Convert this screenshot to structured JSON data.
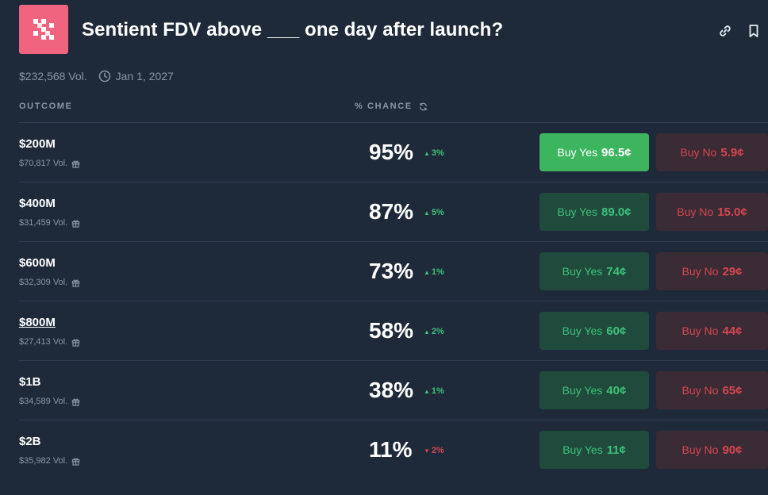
{
  "header": {
    "title": "Sentient FDV above ___ one day after launch?",
    "volume": "$232,568 Vol.",
    "end_date": "Jan 1, 2027",
    "logo_icon": "sentient-logo",
    "link_icon": "link-icon",
    "bookmark_icon": "bookmark-icon"
  },
  "columns": {
    "outcome": "OUTCOME",
    "chance": "% CHANCE"
  },
  "colors": {
    "background": "#1e2a3a",
    "accent_logo": "#f06480",
    "up": "#3dc27a",
    "down": "#d54652",
    "yes_active": "#3cb55e"
  },
  "outcomes": [
    {
      "name": "$200M",
      "volume": "$70,817 Vol.",
      "chance": "95%",
      "change": "3%",
      "direction": "up",
      "yes_label": "Buy Yes",
      "yes_price": "96.5¢",
      "no_label": "Buy No",
      "no_price": "5.9¢"
    },
    {
      "name": "$400M",
      "volume": "$31,459 Vol.",
      "chance": "87%",
      "change": "5%",
      "direction": "up",
      "yes_label": "Buy Yes",
      "yes_price": "89.0¢",
      "no_label": "Buy No",
      "no_price": "15.0¢"
    },
    {
      "name": "$600M",
      "volume": "$32,309 Vol.",
      "chance": "73%",
      "change": "1%",
      "direction": "up",
      "yes_label": "Buy Yes",
      "yes_price": "74¢",
      "no_label": "Buy No",
      "no_price": "29¢"
    },
    {
      "name": "$800M",
      "volume": "$27,413 Vol.",
      "chance": "58%",
      "change": "2%",
      "direction": "up",
      "yes_label": "Buy Yes",
      "yes_price": "60¢",
      "no_label": "Buy No",
      "no_price": "44¢"
    },
    {
      "name": "$1B",
      "volume": "$34,589 Vol.",
      "chance": "38%",
      "change": "1%",
      "direction": "up",
      "yes_label": "Buy Yes",
      "yes_price": "40¢",
      "no_label": "Buy No",
      "no_price": "65¢"
    },
    {
      "name": "$2B",
      "volume": "$35,982 Vol.",
      "chance": "11%",
      "change": "2%",
      "direction": "down",
      "yes_label": "Buy Yes",
      "yes_price": "11¢",
      "no_label": "Buy No",
      "no_price": "90¢"
    }
  ]
}
